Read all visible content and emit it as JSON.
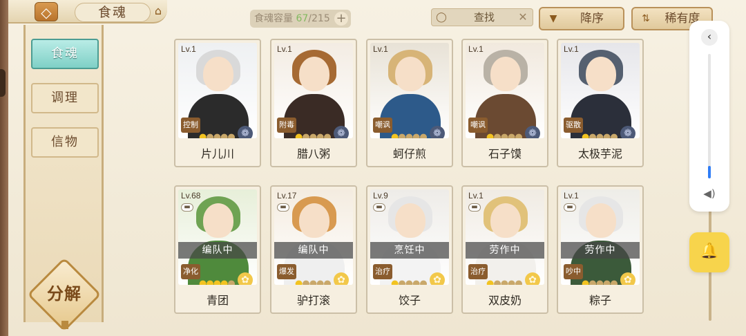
{
  "header": {
    "back_icon": "back-arrow-icon",
    "title": "食魂",
    "ornament_icon": "pagoda-icon",
    "capacity_label": "食魂容量",
    "capacity_current": "67",
    "capacity_total": "/215",
    "add_symbol": "+"
  },
  "search": {
    "label": "查找",
    "search_icon": "magnifier-icon",
    "clear_symbol": "✕"
  },
  "sort": {
    "order_label": "降序",
    "order_icon": "triangle-down-icon",
    "rarity_label": "稀有度",
    "rarity_icon": "sort-icon"
  },
  "sidebar": {
    "tabs": [
      {
        "label": "食魂",
        "active": true
      },
      {
        "label": "调理",
        "active": false
      },
      {
        "label": "信物",
        "active": false
      }
    ],
    "decompose_label": "分解"
  },
  "cards": [
    {
      "level": "Lv.1",
      "role": "控制",
      "name": "片儿川",
      "stars": 1,
      "element": "moon",
      "status": "",
      "colors": {
        "hair": "#d9d9d9",
        "body": "#2b2b2b",
        "bg": "#eef0f2"
      }
    },
    {
      "level": "Lv.1",
      "role": "附毒",
      "name": "腊八粥",
      "stars": 1,
      "element": "moon",
      "status": "",
      "colors": {
        "hair": "#a66a33",
        "body": "#3a2b25",
        "bg": "#f3ece3"
      }
    },
    {
      "level": "Lv.1",
      "role": "嘲讽",
      "name": "蚵仔煎",
      "stars": 1,
      "element": "moon",
      "status": "",
      "colors": {
        "hair": "#d7b477",
        "body": "#2d5a8a",
        "bg": "#e8e2d6"
      }
    },
    {
      "level": "Lv.1",
      "role": "嘲讽",
      "name": "石子馍",
      "stars": 1,
      "element": "moon",
      "status": "",
      "colors": {
        "hair": "#b9b2a6",
        "body": "#6b4a32",
        "bg": "#f1e9de"
      }
    },
    {
      "level": "Lv.1",
      "role": "驱散",
      "name": "太极芋泥",
      "stars": 1,
      "element": "moon",
      "status": "",
      "colors": {
        "hair": "#556070",
        "body": "#2b2f3a",
        "bg": "#e6e6ea"
      }
    },
    {
      "level": "Lv.68",
      "role": "净化",
      "name": "青团",
      "stars": 4,
      "element": "sun",
      "status": "编队中",
      "colors": {
        "hair": "#6fa353",
        "body": "#4f8a3c",
        "bg": "#e7efd9"
      }
    },
    {
      "level": "Lv.17",
      "role": "爆发",
      "name": "驴打滚",
      "stars": 1,
      "element": "sun",
      "status": "编队中",
      "colors": {
        "hair": "#d89a50",
        "body": "#efefef",
        "bg": "#f4ece0"
      }
    },
    {
      "level": "Lv.9",
      "role": "治疗",
      "name": "饺子",
      "stars": 1,
      "element": "sun",
      "status": "烹饪中",
      "colors": {
        "hair": "#e6e6e6",
        "body": "#f3f3f3",
        "bg": "#eeece8"
      }
    },
    {
      "level": "Lv.1",
      "role": "治疗",
      "name": "双皮奶",
      "stars": 1,
      "element": "sun",
      "status": "劳作中",
      "colors": {
        "hair": "#e1c27a",
        "body": "#f2f0ec",
        "bg": "#f0ebe3"
      }
    },
    {
      "level": "Lv.1",
      "role": "吵中",
      "name": "粽子",
      "stars": 1,
      "element": "sun",
      "status": "劳作中",
      "colors": {
        "hair": "#e6e6e6",
        "body": "#3b5a3a",
        "bg": "#eeede8"
      }
    }
  ],
  "system_overlay": {
    "back_symbol": "‹",
    "volume_level": 0.1,
    "volume_icon": "speaker-icon",
    "bell_icon": "bell-icon"
  }
}
